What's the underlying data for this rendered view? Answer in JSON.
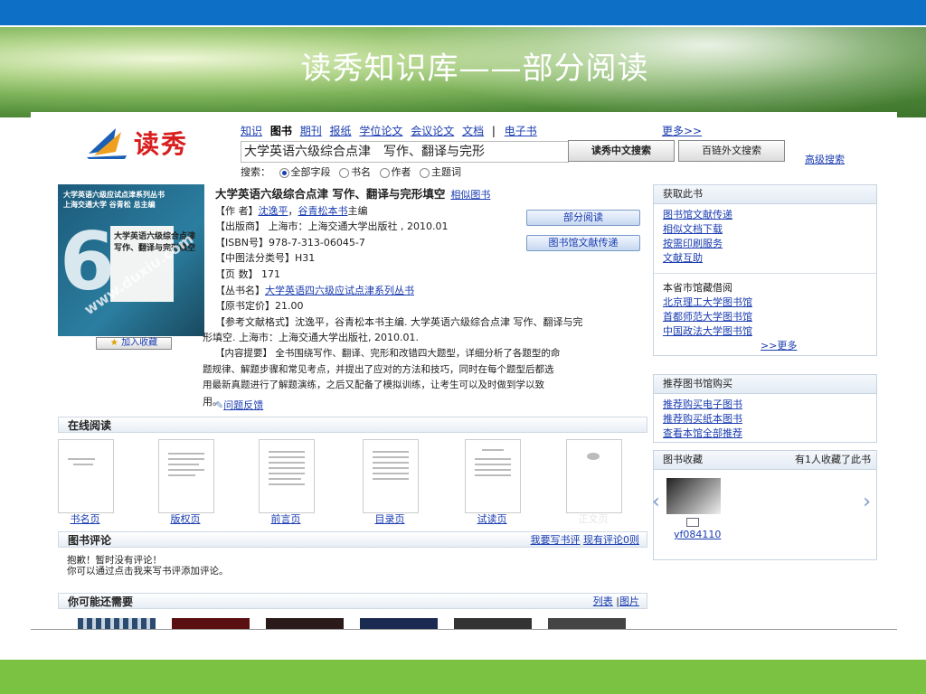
{
  "slide": {
    "title": "读秀知识库——部分阅读"
  },
  "logo": {
    "text": "读秀"
  },
  "nav": {
    "items": [
      "知识",
      "图书",
      "期刊",
      "报纸",
      "学位论文",
      "会议论文",
      "文档",
      "电子书"
    ],
    "more": "更多>>"
  },
  "search": {
    "value": "大学英语六级综合点津　写作、翻译与完形",
    "btn_cn": "读秀中文搜索",
    "btn_en": "百链外文搜索",
    "advanced": "高级搜索",
    "label": "搜索：",
    "options": [
      "全部字段",
      "书名",
      "作者",
      "主题词"
    ]
  },
  "cover": {
    "header": "大学英语六级应试点津系列丛书\n上海交通大学 谷青松 总主编",
    "title": "大学英语六级综合点津\n写作、翻译与完形填空",
    "watermark": "www.duxiu.com"
  },
  "favorite_button": "加入收藏",
  "book": {
    "title": "大学英语六级综合点津 写作、翻译与完形填空",
    "similar": "相似图书",
    "author_label": "【作 者】",
    "authors": [
      "沈逸平",
      "谷青松本书"
    ],
    "author_sep": "，",
    "author_suffix": "主编",
    "publisher": "【出版商】 上海市：上海交通大学出版社 , 2010.01",
    "isbn": "【ISBN号】978-7-313-06045-7",
    "clc": "【中图法分类号】H31",
    "pages": "【页 数】 171",
    "series_label": "【丛书名】",
    "series": "大学英语四六级应试点津系列丛书",
    "price": "【原书定价】21.00",
    "ref_label": "【参考文献格式】",
    "ref_1": "沈逸平，谷青松本书主编. 大学英语六级综合点津 写作、翻译与完",
    "ref_2": "形填空. 上海市：上海交通大学出版社, 2010.01.",
    "summary_1": "【内容提要】 全书围绕写作、翻译、完形和改错四大题型，详细分析了各题型的命",
    "summary_2": "题规律、解题步骤和常见考点，并提出了应对的方法和技巧，同时在每个题型后都选",
    "summary_3": "用最新真题进行了解题演练，之后又配备了模拟训练，让考生可以及时做到学以致",
    "summary_4": "用。",
    "btn_partial": "部分阅读",
    "btn_deliver": "图书馆文献传递",
    "feedback": "问题反馈"
  },
  "online": {
    "title": "在线阅读",
    "pages": [
      "书名页",
      "版权页",
      "前言页",
      "目录页",
      "试读页",
      "正文页"
    ]
  },
  "review": {
    "title": "图书评论",
    "write": "我要写书评",
    "count": "现有评论0则",
    "msg_1": "抱歉！暂时没有评论！",
    "msg_2": "你可以通过点击我来写书评添加评论。"
  },
  "need": {
    "title": "你可能还需要",
    "list": "列表",
    "sep": "|",
    "pic": "图片"
  },
  "panel_get": {
    "title": "获取此书",
    "links": [
      "图书馆文献传递",
      "相似文档下载",
      "按需印刷服务",
      "文献互助"
    ],
    "hold_label": "本省市馆藏借阅",
    "libs": [
      "北京理工大学图书馆",
      "首都师范大学图书馆",
      "中国政法大学图书馆"
    ],
    "more": ">>更多"
  },
  "panel_rec": {
    "title": "推荐图书馆购买",
    "links": [
      "推荐购买电子图书",
      "推荐购买纸本图书",
      "查看本馆全部推荐"
    ]
  },
  "panel_fav": {
    "title": "图书收藏",
    "count": "有1人收藏了此书",
    "user": "yf084110"
  },
  "colors": {
    "top_bar": "#0e6fc6",
    "bottom_bar": "#7cc242",
    "link": "#1a3cb0",
    "logo": "#d81e1e"
  }
}
